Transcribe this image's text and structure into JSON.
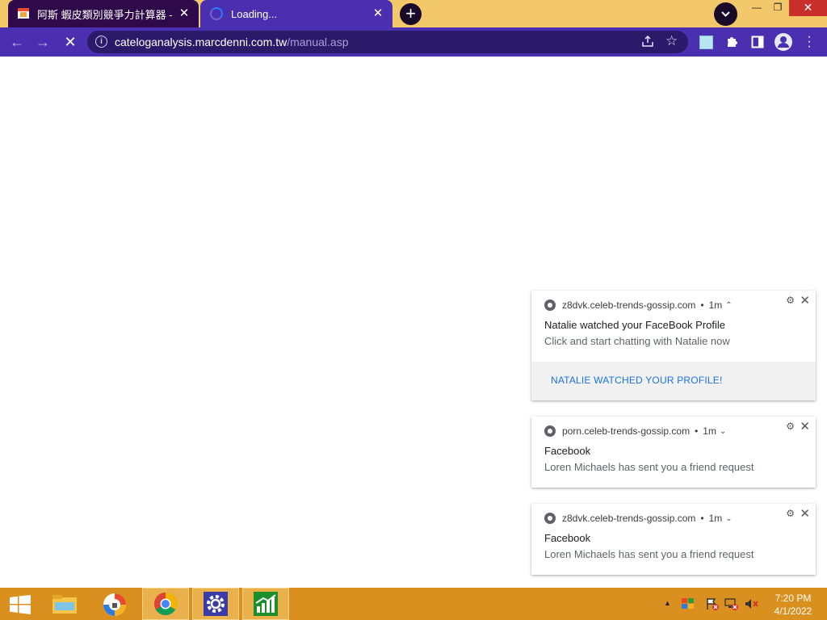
{
  "browser": {
    "tabs": [
      {
        "title": "阿斯 蝦皮類別競爭力計算器 - Ch",
        "state": "active"
      },
      {
        "title": "Loading...",
        "state": "loading"
      }
    ],
    "url_host": "cateloganalysis.marcdenni.com.tw",
    "url_path": "/manual.asp",
    "colors": {
      "tabstrip": "#f2c86a",
      "toolbar": "#4b2fb1",
      "active_tab": "#2e0a4a"
    }
  },
  "notifications": [
    {
      "source": "z8dvk.celeb-trends-gossip.com",
      "age": "1m",
      "expanded": true,
      "title": "Natalie watched your FaceBook Profile",
      "body": "Click and start chatting with Natalie now",
      "action": "NATALIE WATCHED YOUR PROFILE!"
    },
    {
      "source": "porn.celeb-trends-gossip.com",
      "age": "1m",
      "expanded": false,
      "title": "Facebook",
      "body": "Loren Michaels has sent you a friend request"
    },
    {
      "source": "z8dvk.celeb-trends-gossip.com",
      "age": "1m",
      "expanded": false,
      "title": "Facebook",
      "body": "Loren Michaels has sent you a friend request"
    }
  ],
  "taskbar": {
    "apps": [
      "start",
      "file-explorer",
      "security-app",
      "chrome",
      "settings",
      "finance-app"
    ],
    "clock_time": "7:20 PM",
    "clock_date": "4/1/2022"
  }
}
